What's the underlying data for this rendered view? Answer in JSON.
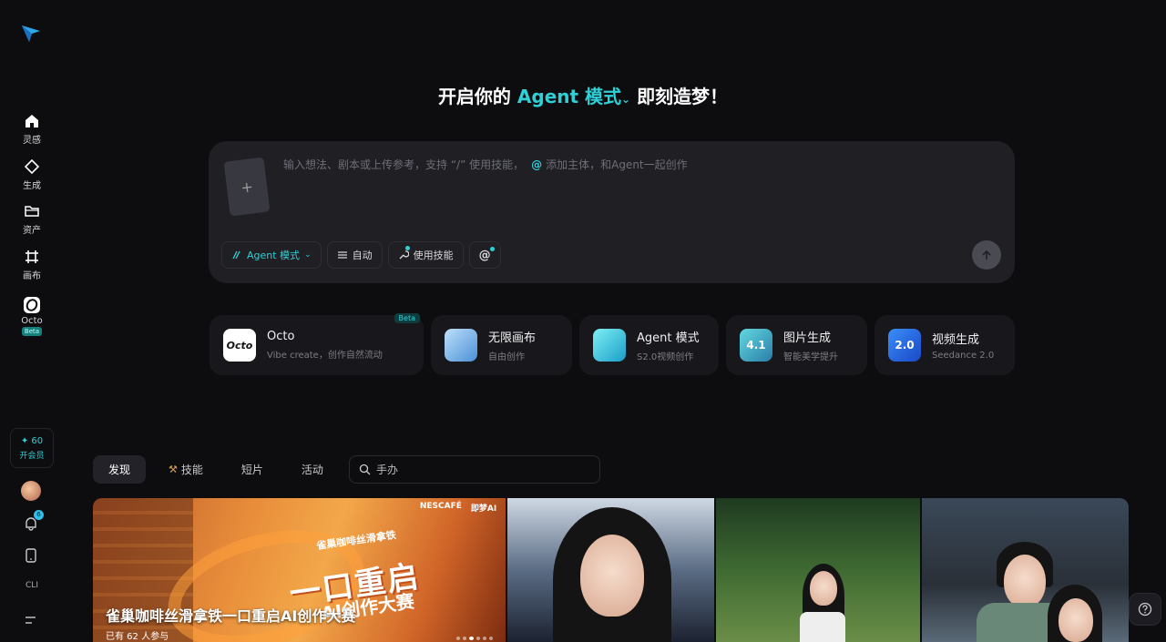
{
  "sidebar": {
    "items": [
      {
        "label": "灵感",
        "icon": "home-icon"
      },
      {
        "label": "生成",
        "icon": "diamond-icon"
      },
      {
        "label": "资产",
        "icon": "folder-icon"
      },
      {
        "label": "画布",
        "icon": "canvas-grid-icon"
      },
      {
        "label": "Octo",
        "icon": "octo-icon",
        "badge": "Beta"
      }
    ],
    "credits": "✦ 60",
    "vip_label": "开会员",
    "notification_count": "6",
    "cli_label": "CLI"
  },
  "hero": {
    "prefix": "开启你的",
    "mode": "Agent 模式",
    "suffix": "即刻造梦！"
  },
  "prompt": {
    "placeholder_part1": "输入想法、剧本或上传参考，支持 “/” 使用技能，",
    "placeholder_at": "@",
    "placeholder_part2": "添加主体，和Agent一起创作",
    "chips": {
      "agent": "Agent 模式",
      "auto": "自动",
      "skill": "使用技能",
      "at": "@"
    }
  },
  "cards": [
    {
      "title": "Octo",
      "subtitle": "Vibe create，创作自然流动",
      "badge": "Beta",
      "icon_text": "Octo"
    },
    {
      "title": "无限画布",
      "subtitle": "自由创作",
      "icon_text": ""
    },
    {
      "title": "Agent 模式",
      "subtitle": "S2.0视频创作",
      "icon_text": ""
    },
    {
      "title": "图片生成",
      "subtitle": "智能美学提升",
      "icon_text": "4.1"
    },
    {
      "title": "视频生成",
      "subtitle": "Seedance 2.0",
      "icon_text": "2.0"
    }
  ],
  "tabs": [
    {
      "label": "发现",
      "active": true
    },
    {
      "label": "技能",
      "active": false
    },
    {
      "label": "短片",
      "active": false
    },
    {
      "label": "活动",
      "active": false
    }
  ],
  "search": {
    "value": "",
    "placeholder": "手办"
  },
  "banner": {
    "brand_a": "NESCAFÉ",
    "brand_b": "即梦AI",
    "headline_small": "雀巢咖啡丝滑拿铁",
    "headline_big": "一口重启",
    "headline_sub": "AI创作大赛",
    "title": "雀巢咖啡丝滑拿铁一口重启AI创作大赛",
    "participants": "已有 62 人参与"
  },
  "colors": {
    "accent": "#2ed0d8",
    "background": "#0d0d10",
    "card": "#18181c"
  }
}
